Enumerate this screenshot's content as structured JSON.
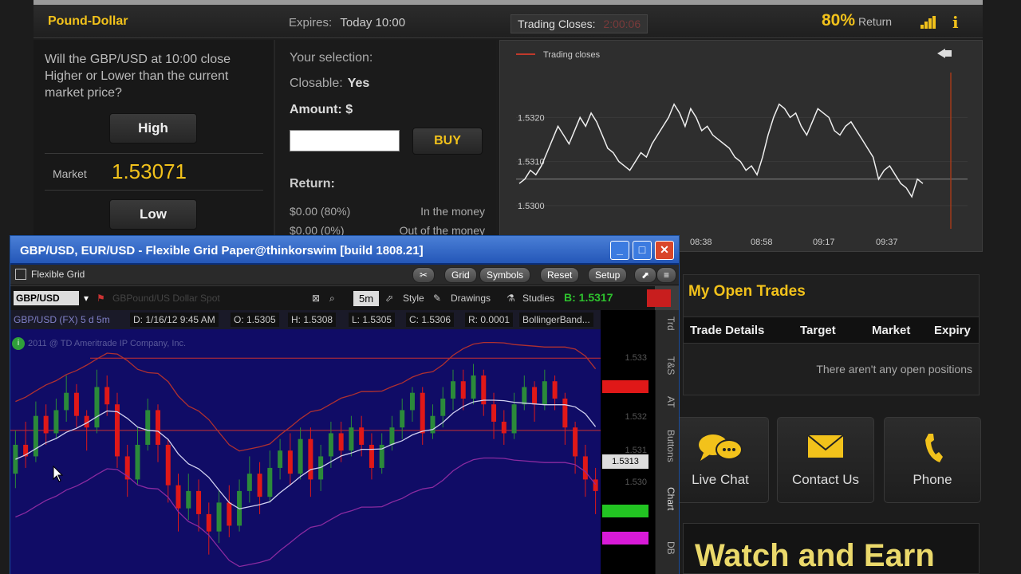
{
  "page": {
    "pair_title": "Pound-Dollar",
    "expires_label": "Expires:",
    "expires_value": "Today 10:00",
    "trading_closes_label": "Trading Closes:",
    "trading_closes_value": "2:00:06",
    "return_pct": "80%",
    "return_label": "Return",
    "question": "Will the GBP/USD at 10:00 close Higher or Lower than the current market price?",
    "high_label": "High",
    "low_label": "Low",
    "market_label": "Market",
    "market_value": "1.53071",
    "your_selection_label": "Your selection:",
    "closable_label": "Closable:",
    "closable_value": "Yes",
    "amount_label": "Amount: $",
    "amount_value": "",
    "buy_label": "BUY",
    "return_title": "Return:",
    "return_in_value": "$0.00 (80%)",
    "return_in_label": "In the money",
    "return_out_value": "$0.00 (0%)",
    "return_out_label": "Out of the money"
  },
  "mini_chart": {
    "legend": "Trading closes",
    "y_labels": [
      "1.5320",
      "1.5310",
      "1.5300"
    ],
    "x_labels": [
      "08:38",
      "08:58",
      "09:17",
      "09:37"
    ],
    "ylim": [
      1.5294,
      1.5332
    ],
    "baseline": 1.5306,
    "values": [
      1.5305,
      1.5306,
      1.5308,
      1.5307,
      1.5309,
      1.5312,
      1.5315,
      1.5318,
      1.5316,
      1.5314,
      1.5317,
      1.532,
      1.5318,
      1.5321,
      1.5319,
      1.5316,
      1.5313,
      1.5312,
      1.531,
      1.5309,
      1.5308,
      1.531,
      1.5312,
      1.5311,
      1.5314,
      1.5316,
      1.5318,
      1.532,
      1.5323,
      1.5321,
      1.5318,
      1.5322,
      1.532,
      1.5317,
      1.5318,
      1.5316,
      1.5315,
      1.5314,
      1.5313,
      1.5311,
      1.531,
      1.5308,
      1.5309,
      1.5307,
      1.5311,
      1.5316,
      1.532,
      1.5323,
      1.5322,
      1.532,
      1.5321,
      1.5318,
      1.5316,
      1.5319,
      1.5322,
      1.5321,
      1.532,
      1.5317,
      1.5316,
      1.5318,
      1.5319,
      1.5317,
      1.5315,
      1.5313,
      1.5311,
      1.5306,
      1.5308,
      1.5309,
      1.5307,
      1.5305,
      1.5304,
      1.5302,
      1.5306,
      1.5305
    ]
  },
  "open_trades": {
    "title": "My Open Trades",
    "columns": [
      "Trade Details",
      "Target",
      "Market",
      "Expiry"
    ],
    "empty_message": "There aren't any open positions"
  },
  "contact": {
    "live_chat": "Live Chat",
    "contact_us": "Contact Us",
    "phone": "Phone"
  },
  "banner": "Watch and Earn",
  "tos": {
    "title": "GBP/USD, EUR/USD - Flexible Grid Paper@thinkorswim [build 1808.21]",
    "toolbar_label": "Flexible Grid",
    "toolbar_buttons": [
      "Grid",
      "Symbols",
      "Reset",
      "Setup"
    ],
    "symbol": "GBP/USD",
    "symbol_desc": "GBPound/US Dollar Spot",
    "timeframe": "5m",
    "style_label": "Style",
    "drawings_label": "Drawings",
    "studies_label": "Studies",
    "bid_value": "B: 1.5317",
    "info_label": "GBP/USD (FX) 5 d 5m",
    "info_date": "D: 1/16/12 9:45 AM",
    "info_open": "O: 1.5305",
    "info_high": "H: 1.5308",
    "info_low": "L: 1.5305",
    "info_close": "C: 1.5306",
    "info_range": "R: 0.0001",
    "info_study": "BollingerBand...",
    "copyright": "2011 @ TD Ameritrade IP Company, Inc.",
    "price_labels": [
      "1.533",
      "1.532",
      "1.531",
      "1.530"
    ],
    "current_price": "1.5313",
    "side_tabs": [
      "Trd",
      "T&S",
      "AT",
      "Buttons",
      "Chart",
      "DB"
    ],
    "colors": {
      "up": "#2b8a3a",
      "down": "#e01818",
      "bg": "#100c66"
    },
    "candles": [
      [
        1.529,
        1.53,
        1.5285,
        1.5305
      ],
      [
        1.53,
        1.5296,
        1.5292,
        1.5308
      ],
      [
        1.5296,
        1.531,
        1.5294,
        1.5315
      ],
      [
        1.531,
        1.5304,
        1.53,
        1.5314
      ],
      [
        1.5304,
        1.5312,
        1.5302,
        1.5316
      ],
      [
        1.5312,
        1.5318,
        1.5308,
        1.5324
      ],
      [
        1.5318,
        1.531,
        1.5306,
        1.5321
      ],
      [
        1.531,
        1.5306,
        1.5298,
        1.5312
      ],
      [
        1.5306,
        1.532,
        1.5304,
        1.5326
      ],
      [
        1.532,
        1.5314,
        1.531,
        1.5324
      ],
      [
        1.5314,
        1.5296,
        1.5292,
        1.5318
      ],
      [
        1.5296,
        1.5288,
        1.5282,
        1.53
      ],
      [
        1.5288,
        1.53,
        1.5286,
        1.5306
      ],
      [
        1.53,
        1.5312,
        1.5298,
        1.5316
      ],
      [
        1.5312,
        1.53,
        1.5294,
        1.5314
      ],
      [
        1.53,
        1.5286,
        1.528,
        1.5302
      ],
      [
        1.5286,
        1.5278,
        1.527,
        1.529
      ],
      [
        1.5278,
        1.5284,
        1.5274,
        1.529
      ],
      [
        1.5284,
        1.5276,
        1.527,
        1.5288
      ],
      [
        1.5276,
        1.527,
        1.5262,
        1.528
      ],
      [
        1.527,
        1.528,
        1.5266,
        1.5284
      ],
      [
        1.528,
        1.5272,
        1.5268,
        1.5286
      ],
      [
        1.5272,
        1.5284,
        1.527,
        1.5288
      ],
      [
        1.5284,
        1.529,
        1.528,
        1.5296
      ],
      [
        1.529,
        1.5282,
        1.5276,
        1.5294
      ],
      [
        1.5282,
        1.5292,
        1.528,
        1.5298
      ],
      [
        1.5292,
        1.5298,
        1.5288,
        1.5302
      ],
      [
        1.5298,
        1.529,
        1.5286,
        1.5304
      ],
      [
        1.529,
        1.5302,
        1.5288,
        1.5306
      ],
      [
        1.5302,
        1.5288,
        1.5282,
        1.5306
      ],
      [
        1.5288,
        1.5296,
        1.5284,
        1.53
      ],
      [
        1.5296,
        1.5304,
        1.5292,
        1.5308
      ],
      [
        1.5304,
        1.5298,
        1.5294,
        1.5308
      ],
      [
        1.5298,
        1.5306,
        1.5296,
        1.531
      ],
      [
        1.5306,
        1.53,
        1.5296,
        1.531
      ],
      [
        1.53,
        1.5292,
        1.5288,
        1.5304
      ],
      [
        1.5292,
        1.53,
        1.529,
        1.5304
      ],
      [
        1.53,
        1.5306,
        1.5298,
        1.531
      ],
      [
        1.5306,
        1.5312,
        1.5302,
        1.5316
      ],
      [
        1.5312,
        1.5318,
        1.5308,
        1.532
      ],
      [
        1.5318,
        1.5304,
        1.53,
        1.532
      ],
      [
        1.5304,
        1.531,
        1.5302,
        1.5314
      ],
      [
        1.531,
        1.5316,
        1.5306,
        1.532
      ],
      [
        1.5316,
        1.5322,
        1.5312,
        1.5326
      ],
      [
        1.5322,
        1.5316,
        1.5312,
        1.5326
      ],
      [
        1.5316,
        1.5324,
        1.5314,
        1.5328
      ],
      [
        1.5324,
        1.5314,
        1.531,
        1.5326
      ],
      [
        1.5314,
        1.5308,
        1.5302,
        1.5318
      ],
      [
        1.5308,
        1.5304,
        1.53,
        1.5312
      ],
      [
        1.5304,
        1.5314,
        1.5302,
        1.5318
      ],
      [
        1.5314,
        1.532,
        1.5312,
        1.5324
      ],
      [
        1.532,
        1.5314,
        1.5308,
        1.5322
      ],
      [
        1.5314,
        1.5322,
        1.5312,
        1.5326
      ],
      [
        1.5322,
        1.5316,
        1.5312,
        1.5324
      ],
      [
        1.5316,
        1.5306,
        1.53,
        1.5318
      ],
      [
        1.5306,
        1.5296,
        1.529,
        1.5308
      ],
      [
        1.5296,
        1.5288,
        1.5282,
        1.53
      ],
      [
        1.5288,
        1.5284,
        1.5276,
        1.5292
      ]
    ]
  }
}
